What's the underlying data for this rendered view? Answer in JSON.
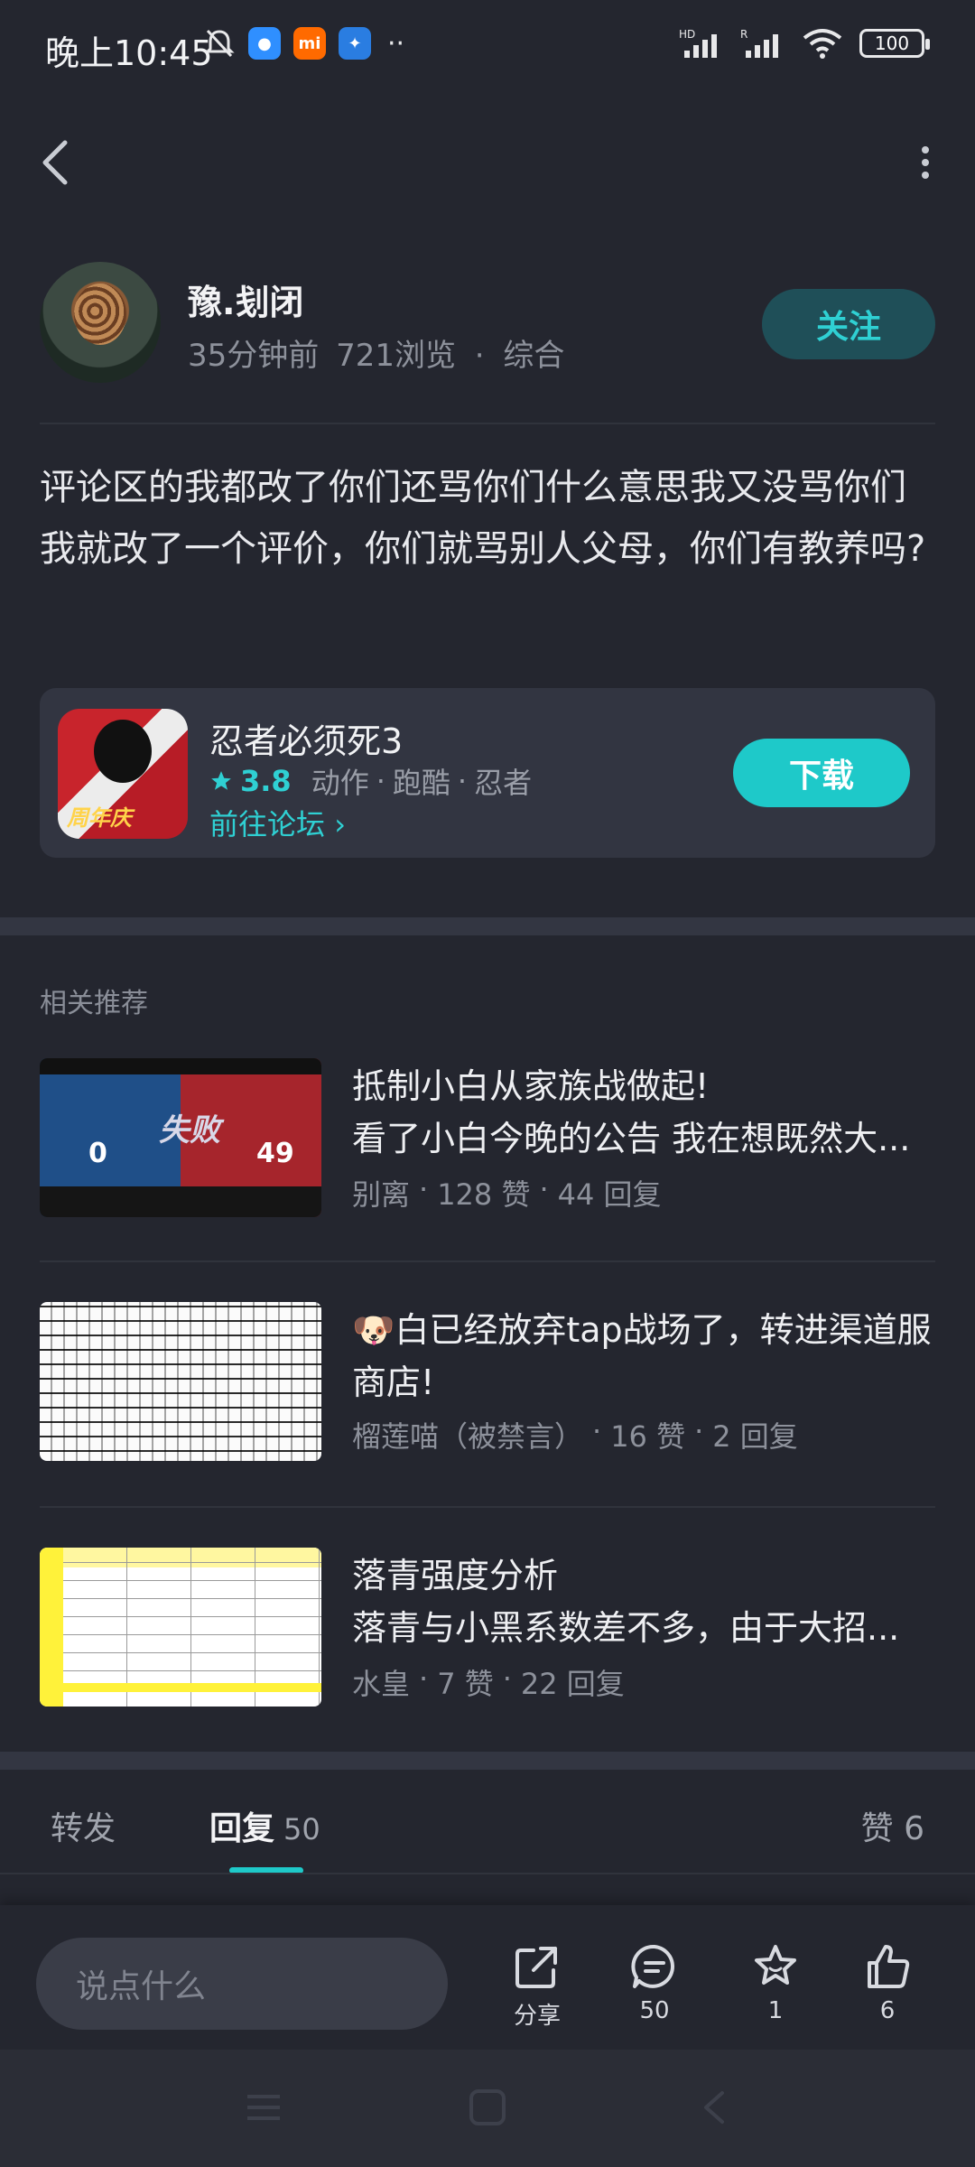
{
  "status_bar": {
    "time": "晚上10:45",
    "battery": "100",
    "network_left": "HD",
    "network_right": "R"
  },
  "author": {
    "name": "豫.刬闭",
    "time_ago": "35分钟前",
    "views": "721浏览",
    "category": "综合",
    "follow_label": "关注"
  },
  "post": {
    "text": "评论区的我都改了你们还骂你们什么意思我又没骂你们我就改了一个评价，你们就骂别人父母，你们有教养吗?"
  },
  "game": {
    "title": "忍者必须死3",
    "rating": "3.8",
    "tags": [
      "动作",
      "跑酷",
      "忍者"
    ],
    "forum_link": "前往论坛",
    "download_label": "下载",
    "icon_badge": "周年庆"
  },
  "related": {
    "section_title": "相关推荐",
    "items": [
      {
        "title": "抵制小白从家族战做起!",
        "subtitle": "看了小白今晚的公告 我在想既然大...",
        "author": "别离",
        "likes": "128 赞",
        "replies": "44 回复",
        "thumb_text": "失败",
        "thumb_score_left": "0",
        "thumb_score_right": "49"
      },
      {
        "title": "🐶白已经放弃tap战场了，转进渠道服商店!",
        "subtitle": "",
        "author": "榴莲喵（被禁言）",
        "likes": "16 赞",
        "replies": "2 回复"
      },
      {
        "title": "落青强度分析",
        "subtitle": "落青与小黑系数差不多，由于大招...",
        "author": "水皇",
        "likes": "7 赞",
        "replies": "22 回复"
      }
    ]
  },
  "tabs": {
    "forward": "转发",
    "reply": "回复",
    "reply_count": "50",
    "likes_label": "赞 6"
  },
  "bottom_bar": {
    "input_placeholder": "说点什么",
    "share_label": "分享",
    "comment_count": "50",
    "favorite_count": "1",
    "like_count": "6"
  },
  "colors": {
    "accent": "#1ec9c9",
    "background": "#24262f",
    "card": "#323541"
  }
}
